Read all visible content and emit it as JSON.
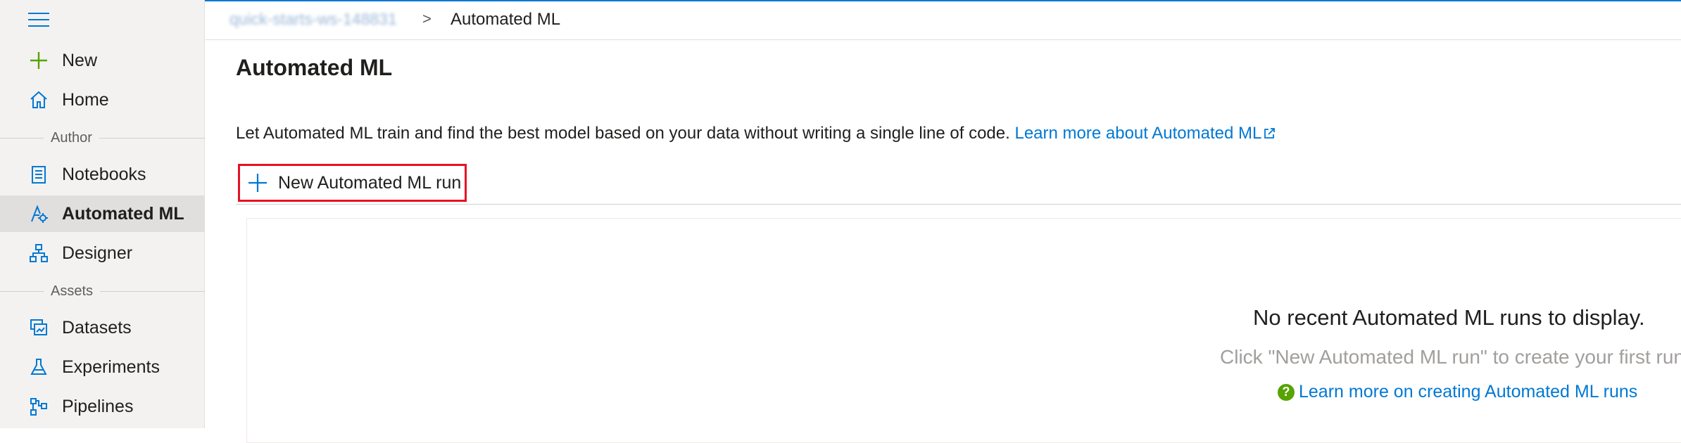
{
  "breadcrumb": {
    "workspace": "quick-starts-ws-148831",
    "separator": ">",
    "current": "Automated ML"
  },
  "sidebar": {
    "items": [
      {
        "label": "New",
        "icon": "plus-icon"
      },
      {
        "label": "Home",
        "icon": "home-icon"
      }
    ],
    "sections": [
      {
        "header": "Author",
        "items": [
          {
            "label": "Notebooks",
            "icon": "notebook-icon"
          },
          {
            "label": "Automated ML",
            "icon": "automated-ml-icon",
            "active": true
          },
          {
            "label": "Designer",
            "icon": "designer-icon"
          }
        ]
      },
      {
        "header": "Assets",
        "items": [
          {
            "label": "Datasets",
            "icon": "datasets-icon"
          },
          {
            "label": "Experiments",
            "icon": "flask-icon"
          },
          {
            "label": "Pipelines",
            "icon": "pipelines-icon"
          }
        ]
      }
    ]
  },
  "main": {
    "title": "Automated ML",
    "description": "Let Automated ML train and find the best model based on your data without writing a single line of code.",
    "learn_more_link": "Learn more about Automated ML",
    "new_run_button": "New Automated ML run",
    "empty_state": {
      "title": "No recent Automated ML runs to display.",
      "subtitle": "Click \"New Automated ML run\" to create your first run.",
      "help_link": "Learn more on creating Automated ML runs",
      "help_icon_glyph": "?"
    }
  },
  "colors": {
    "accent": "#0078d4",
    "highlight_border": "#e81123",
    "help_green": "#57a300",
    "sidebar_bg": "#f3f2f1"
  }
}
